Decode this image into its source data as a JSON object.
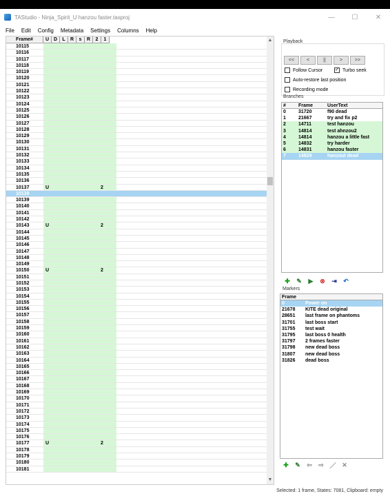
{
  "window": {
    "title": "TAStudio - Ninja_Spirit_U hanzou faster.tasproj",
    "controls": [
      "—",
      "☐",
      "✕"
    ]
  },
  "menu": [
    "File",
    "Edit",
    "Config",
    "Metadata",
    "Settings",
    "Columns",
    "Help"
  ],
  "piano_roll": {
    "columns": [
      "Frame#",
      "U",
      "D",
      "L",
      "R",
      "s",
      "R",
      "2",
      "1"
    ],
    "rows": [
      {
        "frame": "10115"
      },
      {
        "frame": "10116"
      },
      {
        "frame": "10117"
      },
      {
        "frame": "10118"
      },
      {
        "frame": "10119"
      },
      {
        "frame": "10120"
      },
      {
        "frame": "10121"
      },
      {
        "frame": "10122"
      },
      {
        "frame": "10123"
      },
      {
        "frame": "10124"
      },
      {
        "frame": "10125"
      },
      {
        "frame": "10126"
      },
      {
        "frame": "10127"
      },
      {
        "frame": "10128"
      },
      {
        "frame": "10129"
      },
      {
        "frame": "10130"
      },
      {
        "frame": "10131"
      },
      {
        "frame": "10132"
      },
      {
        "frame": "10133"
      },
      {
        "frame": "10134"
      },
      {
        "frame": "10135"
      },
      {
        "frame": "10136"
      },
      {
        "frame": "10137",
        "u": "U",
        "two": "2"
      },
      {
        "frame": "10138",
        "selected": true
      },
      {
        "frame": "10139"
      },
      {
        "frame": "10140"
      },
      {
        "frame": "10141"
      },
      {
        "frame": "10142"
      },
      {
        "frame": "10143",
        "u": "U",
        "two": "2"
      },
      {
        "frame": "10144"
      },
      {
        "frame": "10145"
      },
      {
        "frame": "10146"
      },
      {
        "frame": "10147"
      },
      {
        "frame": "10148"
      },
      {
        "frame": "10149"
      },
      {
        "frame": "10150",
        "u": "U",
        "two": "2"
      },
      {
        "frame": "10151"
      },
      {
        "frame": "10152"
      },
      {
        "frame": "10153"
      },
      {
        "frame": "10154"
      },
      {
        "frame": "10155"
      },
      {
        "frame": "10156"
      },
      {
        "frame": "10157"
      },
      {
        "frame": "10158"
      },
      {
        "frame": "10159"
      },
      {
        "frame": "10160"
      },
      {
        "frame": "10161"
      },
      {
        "frame": "10162"
      },
      {
        "frame": "10163"
      },
      {
        "frame": "10164"
      },
      {
        "frame": "10165"
      },
      {
        "frame": "10166"
      },
      {
        "frame": "10167"
      },
      {
        "frame": "10168"
      },
      {
        "frame": "10169"
      },
      {
        "frame": "10170"
      },
      {
        "frame": "10171"
      },
      {
        "frame": "10172"
      },
      {
        "frame": "10173"
      },
      {
        "frame": "10174"
      },
      {
        "frame": "10175"
      },
      {
        "frame": "10176"
      },
      {
        "frame": "10177",
        "u": "U",
        "two": "2"
      },
      {
        "frame": "10178"
      },
      {
        "frame": "10179"
      },
      {
        "frame": "10180"
      },
      {
        "frame": "10181"
      }
    ]
  },
  "playback": {
    "label": "Playback",
    "buttons": [
      "<<",
      "<",
      "||",
      ">",
      ">>"
    ],
    "follow_cursor": "Follow Cursor",
    "turbo_seek": "Turbo seek",
    "auto_restore": "Auto-restore last position",
    "recording_mode": "Recording mode"
  },
  "branches": {
    "label": "Branches",
    "headers": [
      "#",
      "Frame",
      "UserText"
    ],
    "rows": [
      {
        "n": "0",
        "frame": "31720",
        "text": "f90 dead",
        "style": ""
      },
      {
        "n": "1",
        "frame": "21667",
        "text": "try and fix p2",
        "style": ""
      },
      {
        "n": "2",
        "frame": "14711",
        "text": "test hanzou",
        "style": "green"
      },
      {
        "n": "3",
        "frame": "14814",
        "text": "test ahnzou2",
        "style": "green"
      },
      {
        "n": "4",
        "frame": "14814",
        "text": "hanzou a little fast",
        "style": "green"
      },
      {
        "n": "5",
        "frame": "14832",
        "text": "try harder",
        "style": "green"
      },
      {
        "n": "6",
        "frame": "14831",
        "text": "hanzou faster",
        "style": "green"
      },
      {
        "n": "7",
        "frame": "14829",
        "text": "hanzout dead",
        "style": "blue"
      }
    ]
  },
  "markers": {
    "label": "Markers",
    "headers": [
      "Frame",
      ""
    ],
    "rows": [
      {
        "frame": "0",
        "text": "Power on",
        "style": "blue"
      },
      {
        "frame": "21678",
        "text": "KITE dead original",
        "style": ""
      },
      {
        "frame": "28651",
        "text": "last frame on phantoms",
        "style": ""
      },
      {
        "frame": "31701",
        "text": "last boss start",
        "style": ""
      },
      {
        "frame": "31755",
        "text": "test wait",
        "style": ""
      },
      {
        "frame": "31795",
        "text": "last boss 0 health",
        "style": ""
      },
      {
        "frame": "31797",
        "text": "2 frames faster",
        "style": ""
      },
      {
        "frame": "31798",
        "text": "new dead boss",
        "style": ""
      },
      {
        "frame": "31807",
        "text": "new dead boss",
        "style": ""
      },
      {
        "frame": "31826",
        "text": "dead boss",
        "style": ""
      }
    ]
  },
  "status": "Selected: 1 frame, States: 7081, Clipboard: empty"
}
